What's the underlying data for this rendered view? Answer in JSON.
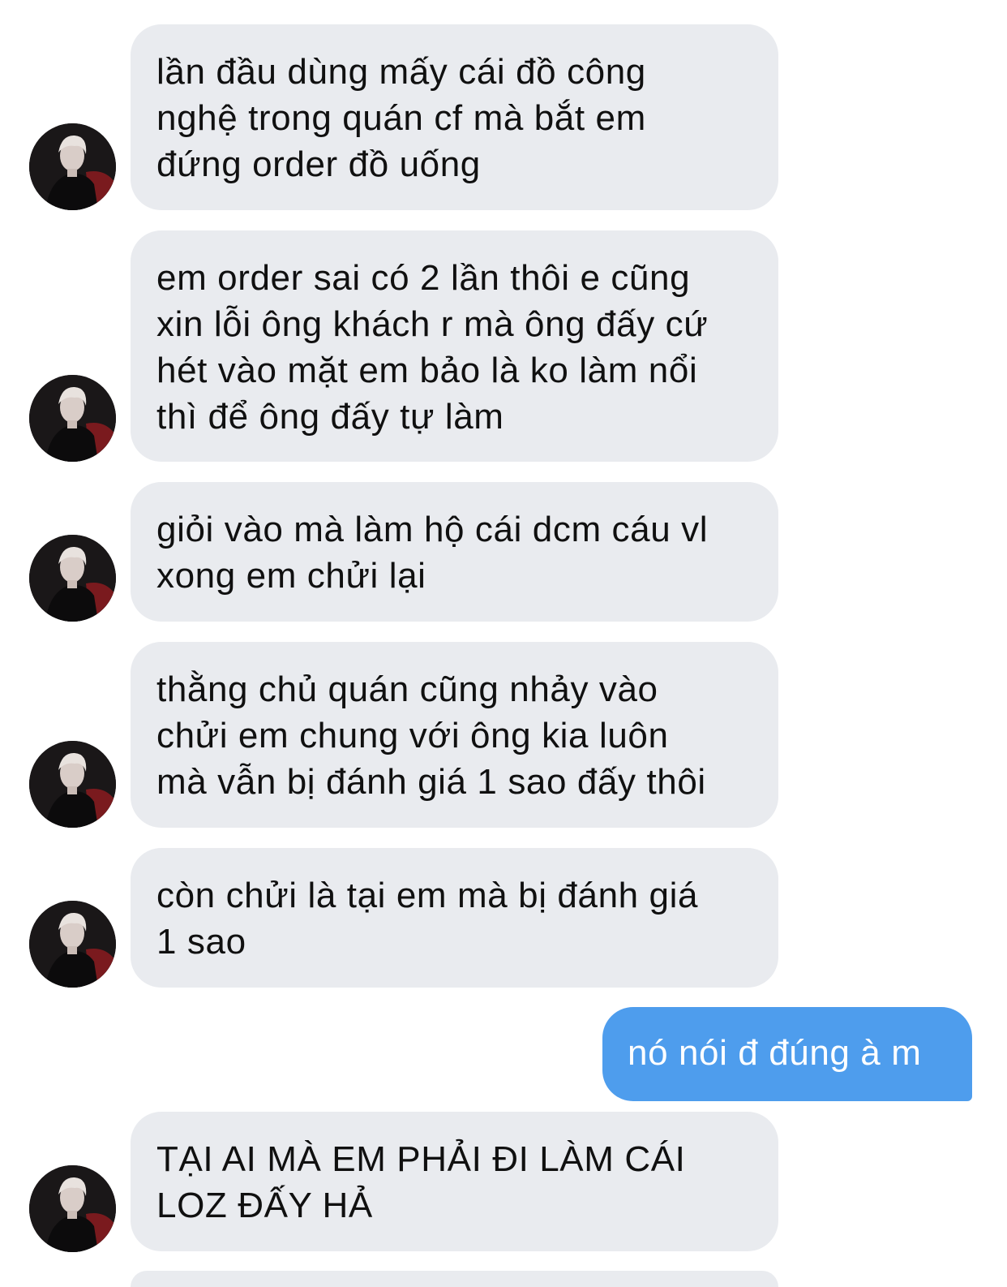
{
  "conversation": {
    "messages": [
      {
        "sender": "other",
        "text": "lần đầu dùng mấy cái đồ công\nnghệ trong quán cf mà bắt em\nđứng order đồ uống"
      },
      {
        "sender": "other",
        "text": "em order sai có 2 lần thôi e cũng\nxin lỗi ông khách r mà ông đấy cứ\nhét vào mặt em bảo là ko làm nổi\nthì để ông đấy tự làm"
      },
      {
        "sender": "other",
        "text": "giỏi vào mà làm hộ cái dcm cáu vl\nxong em chửi lại"
      },
      {
        "sender": "other",
        "text": "thằng chủ quán cũng nhảy vào\nchửi em chung với ông kia luôn\nmà vẫn bị đánh giá 1 sao đấy thôi"
      },
      {
        "sender": "other",
        "text": "còn chửi là tại em mà bị đánh giá\n1 sao"
      },
      {
        "sender": "me",
        "text": "nó nói đ đúng à m"
      },
      {
        "sender": "other",
        "text": "TẠI AI MÀ EM PHẢI ĐI LÀM CÁI\nLOZ ĐẤY HẢ"
      }
    ]
  },
  "colors": {
    "incoming_bubble": "#e9ebef",
    "outgoing_bubble": "#4e9ded",
    "incoming_text": "#101010",
    "outgoing_text": "#ffffff"
  },
  "icons": {
    "avatar": "profile-photo-avatar"
  }
}
